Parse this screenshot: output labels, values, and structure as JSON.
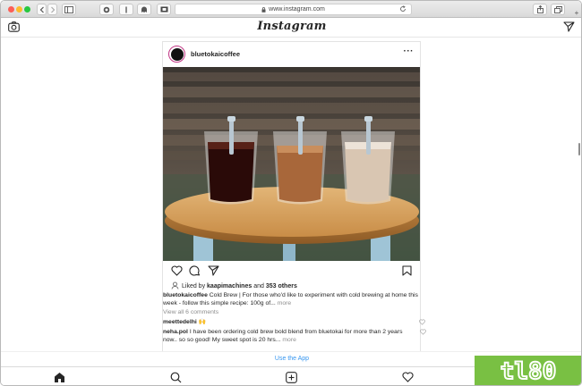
{
  "browser": {
    "url": "www.instagram.com"
  },
  "header": {
    "logo": "Instagram"
  },
  "post": {
    "username": "bluetokaicoffee",
    "more_label": "···",
    "likes_prefix": "Liked by",
    "likes_user": "kaapimachines",
    "likes_and": "and",
    "likes_others": "353 others",
    "caption_user": "bluetokaicoffee",
    "caption_text": "Cold Brew | For those who'd like to experiment with cold brewing at home this week - follow this simple recipe: 100g of...",
    "caption_more": "more",
    "view_all": "View all 6 comments",
    "comments": [
      {
        "user": "meettedelhi",
        "text": "🙌"
      },
      {
        "user": "neha.pol",
        "text": "I have been ordering cold brew bold blend from bluetokai for more than 2 years now.. so so good! My sweet spot is 20 hrs...",
        "more": "more"
      }
    ]
  },
  "banner": {
    "use_app": "Use the App"
  },
  "watermark": "tl80",
  "icons": {
    "camera": "camera-icon",
    "direct": "direct-send-icon",
    "like": "heart-icon",
    "comment": "comment-icon",
    "share": "share-icon",
    "save": "bookmark-icon",
    "home": "home-icon",
    "search": "search-icon",
    "new_post": "new-post-icon",
    "activity": "activity-heart-icon"
  },
  "colors": {
    "accent": "#3897f0",
    "watermark": "#79c043"
  }
}
